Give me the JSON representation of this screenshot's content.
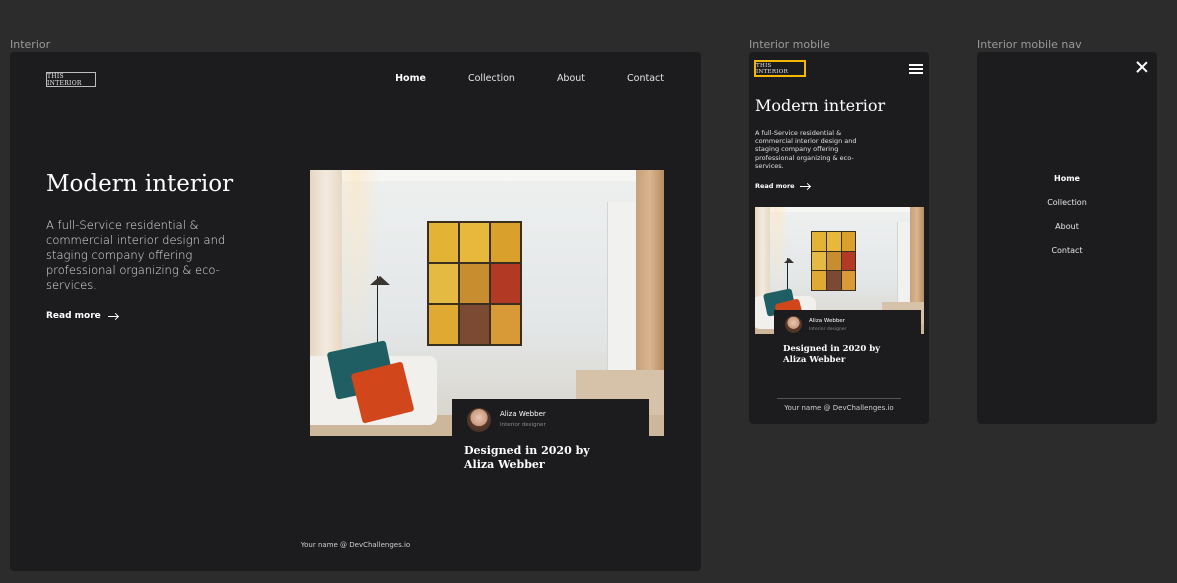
{
  "frames": {
    "desktop_label": "Interior",
    "mobile_label": "Interior mobile",
    "mobile_nav_label": "Interior mobile nav"
  },
  "site": {
    "logo": "THIS INTERIOR",
    "nav": [
      "Home",
      "Collection",
      "About",
      "Contact"
    ],
    "active_nav": "Home",
    "hero_title": "Modern interior",
    "hero_desc": "A full-Service residential & commercial interior design and staging company offering professional organizing & eco-services.",
    "read_more": "Read more",
    "card": {
      "name": "Aliza Webber",
      "role": "Interior designer",
      "title": "Designed in 2020 by Aliza Webber"
    },
    "footer": "Your name @ DevChallenges.io"
  },
  "colors": {
    "frame_bg": "#1c1c1e",
    "canvas_bg": "#2c2c2c",
    "logo_highlight": "#f5b800"
  },
  "icons": {
    "menu": "hamburger-menu-icon",
    "close": "close-icon",
    "arrow": "arrow-right-icon"
  }
}
